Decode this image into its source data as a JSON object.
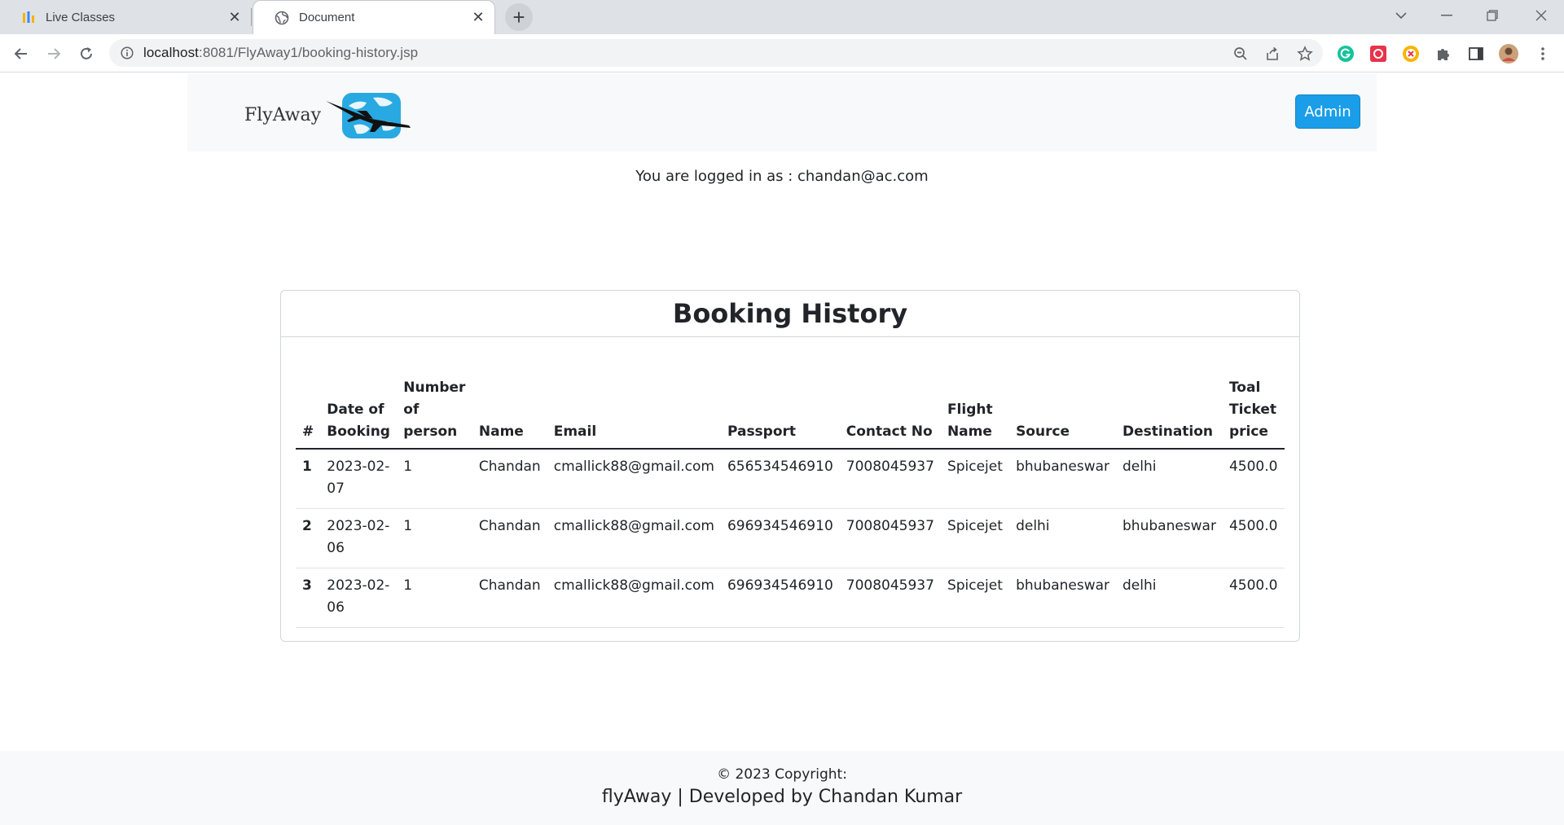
{
  "browser": {
    "tabs": [
      {
        "title": "Live Classes",
        "active": false
      },
      {
        "title": "Document",
        "active": true
      }
    ],
    "url_host": "localhost",
    "url_rest": ":8081/FlyAway1/booking-history.jsp"
  },
  "navbar": {
    "brand": "FlyAway",
    "admin_label": "Admin"
  },
  "session": {
    "logged_in_text": "You are logged in as : chandan@ac.com"
  },
  "booking": {
    "title": "Booking History",
    "columns": [
      "#",
      "Date of Booking",
      "Number of person",
      "Name",
      "Email",
      "Passport",
      "Contact No",
      "Flight Name",
      "Source",
      "Destination",
      "Toal Ticket price"
    ],
    "rows": [
      {
        "idx": "1",
        "date": "2023-02-07",
        "persons": "1",
        "name": "Chandan",
        "email": "cmallick88@gmail.com",
        "passport": "656534546910",
        "contact": "7008045937",
        "flight": "Spicejet",
        "source": "bhubaneswar",
        "destination": "delhi",
        "price": "4500.0"
      },
      {
        "idx": "2",
        "date": "2023-02-06",
        "persons": "1",
        "name": "Chandan",
        "email": "cmallick88@gmail.com",
        "passport": "696934546910",
        "contact": "7008045937",
        "flight": "Spicejet",
        "source": "delhi",
        "destination": "bhubaneswar",
        "price": "4500.0"
      },
      {
        "idx": "3",
        "date": "2023-02-06",
        "persons": "1",
        "name": "Chandan",
        "email": "cmallick88@gmail.com",
        "passport": "696934546910",
        "contact": "7008045937",
        "flight": "Spicejet",
        "source": "bhubaneswar",
        "destination": "delhi",
        "price": "4500.0"
      }
    ]
  },
  "footer": {
    "copyright": "© 2023 Copyright:",
    "developer": "flyAway | Developed by Chandan Kumar"
  },
  "colors": {
    "admin_button": "#1a9ee9",
    "navbar_bg": "#f8f9fa",
    "chrome_tabbar": "#dee1e6"
  }
}
